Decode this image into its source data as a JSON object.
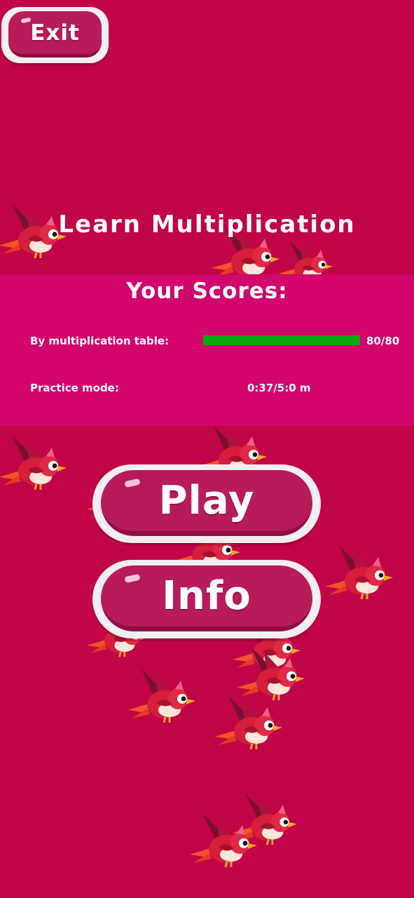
{
  "header": {
    "exit_label": "Exit"
  },
  "title": "Learn Multiplication",
  "scores": {
    "heading": "Your Scores:",
    "table_label": "By multiplication table:",
    "table_progress": 1.0,
    "table_count": "80/80",
    "practice_label": "Practice mode:",
    "practice_time": "0:37/5:0 m"
  },
  "buttons": {
    "play_label": "Play",
    "info_label": "Info"
  },
  "colors": {
    "background": "#c10347",
    "score_panel": "#d2066d",
    "button_face": "#b71b5c",
    "button_rim": "#f4eef0",
    "progress_fill": "#0aa80d"
  },
  "decorations": {
    "bird_icon": "red-cartoon-bird"
  }
}
